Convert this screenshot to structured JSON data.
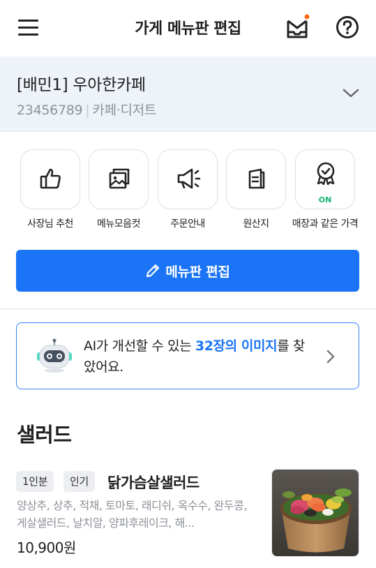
{
  "header": {
    "title": "가게 메뉴판 편집",
    "menu_icon": "hamburger-menu-icon",
    "inbox_icon": "mail-inbox-icon",
    "help_icon": "question-circle-icon",
    "notification_dot_color": "#ff6a13"
  },
  "store": {
    "name": "[배민1] 우아한카페",
    "id": "23456789",
    "separator": "|",
    "category": "카페·디저트"
  },
  "quick_menu": [
    {
      "label": "사장님 추천",
      "icon": "thumbs-up-icon"
    },
    {
      "label": "메뉴모음컷",
      "icon": "image-gallery-icon"
    },
    {
      "label": "주문안내",
      "icon": "megaphone-icon"
    },
    {
      "label": "원산지",
      "icon": "document-icon"
    },
    {
      "label": "매장과 같은 가격",
      "icon": "badge-check-icon",
      "status": "ON"
    }
  ],
  "edit_button": {
    "label": "메뉴판 편집",
    "icon": "pencil-icon"
  },
  "ai_banner": {
    "text_before": "AI가 개선할 수 있는 ",
    "highlight": "32장의 이미지",
    "text_after": "를 찾았어요.",
    "icon": "robot-icon"
  },
  "section": {
    "title": "샐러드"
  },
  "menu_item": {
    "badges": [
      "1인분",
      "인기"
    ],
    "name": "닭가슴살샐러드",
    "description": "양상추, 상추, 적채, 토마토, 래디쉬, 옥수수, 완두콩, 게살샐러드, 날치알, 양파후레이크, 해...",
    "price": "10,900원",
    "image": "salad-bowl-photo"
  },
  "colors": {
    "primary": "#1b74f5",
    "status_on": "#14b372",
    "store_bg": "#eef3fa"
  }
}
